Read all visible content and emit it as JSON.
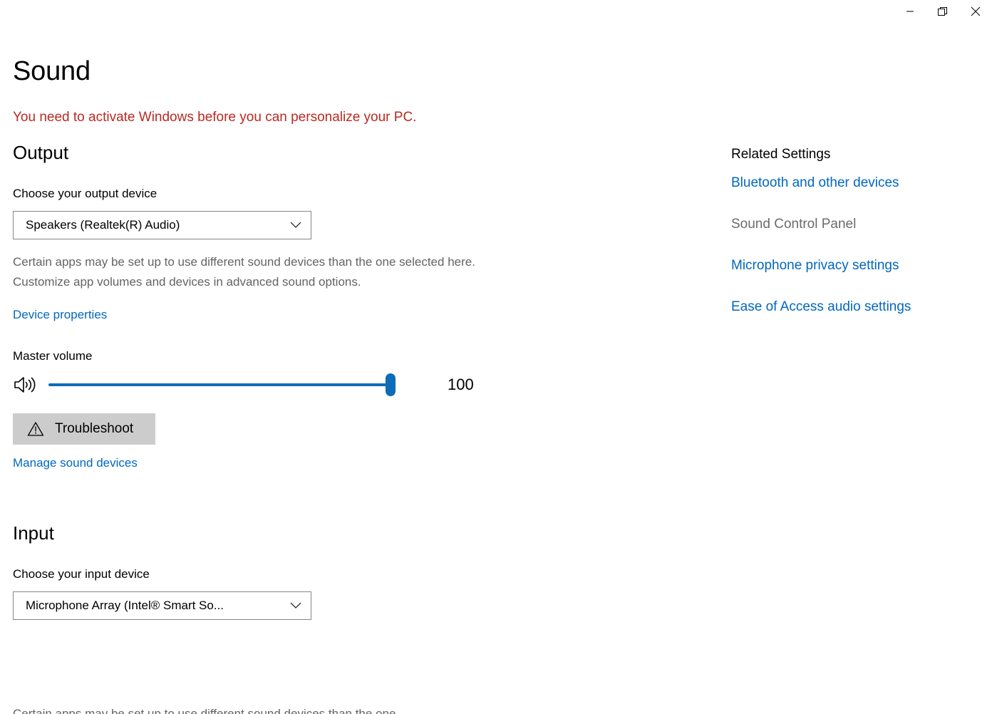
{
  "window": {
    "controls": [
      {
        "name": "minimize",
        "label": "Minimize"
      },
      {
        "name": "restore",
        "label": "Restore"
      },
      {
        "name": "close",
        "label": "Close"
      }
    ]
  },
  "page": {
    "title": "Sound",
    "activation_warning": "You need to activate Windows before you can personalize your PC."
  },
  "output": {
    "heading": "Output",
    "device_label": "Choose your output device",
    "device_value": "Speakers (Realtek(R) Audio)",
    "description": "Certain apps may be set up to use different sound devices than the one selected here. Customize app volumes and devices in advanced sound options.",
    "device_properties_link": "Device properties",
    "volume_label": "Master volume",
    "volume_value": "100",
    "volume_percent": 100,
    "volume_icon": "speaker-high-icon",
    "troubleshoot_label": "Troubleshoot",
    "troubleshoot_icon": "warning-triangle-icon",
    "manage_devices_link": "Manage sound devices"
  },
  "input": {
    "heading": "Input",
    "device_label": "Choose your input device",
    "device_value": "Microphone Array (Intel® Smart So...",
    "description": "Certain apps may be set up to use different sound devices than the one"
  },
  "related_settings": {
    "heading": "Related Settings",
    "links": [
      {
        "label": "Bluetooth and other devices",
        "disabled": false
      },
      {
        "label": "Sound Control Panel",
        "disabled": true
      },
      {
        "label": "Microphone privacy settings",
        "disabled": false
      },
      {
        "label": "Ease of Access audio settings",
        "disabled": false
      }
    ]
  },
  "colors": {
    "accent": "#0067c0",
    "slider": "#0d6cb8",
    "warning_red": "#b92a23",
    "button_bg": "#cccccc",
    "muted_text": "#646464"
  }
}
